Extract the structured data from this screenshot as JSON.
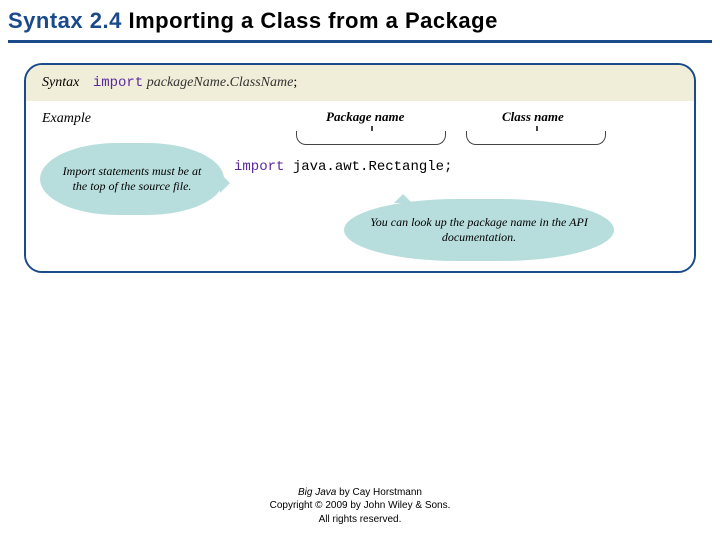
{
  "title": {
    "prefix": "Syntax 2.4",
    "main": " Importing a Class from a Package"
  },
  "syntax_row": {
    "label": "Syntax",
    "keyword": "import",
    "package_placeholder": "packageName",
    "class_placeholder": "ClassName",
    "terminator": ";"
  },
  "example": {
    "label": "Example",
    "annotation_package": "Package name",
    "annotation_class": "Class name",
    "code": {
      "keyword": "import",
      "package": "java.awt",
      "dot": ".",
      "class": "Rectangle",
      "terminator": ";"
    },
    "bubble_left": "Import statements must be at the top of the source file.",
    "bubble_right": "You can look up the package name in the API documentation."
  },
  "footer": {
    "book_title": "Big Java",
    "byline": " by Cay Horstmann",
    "copyright": "Copyright © 2009 by John Wiley & Sons.",
    "rights": "All rights reserved."
  }
}
